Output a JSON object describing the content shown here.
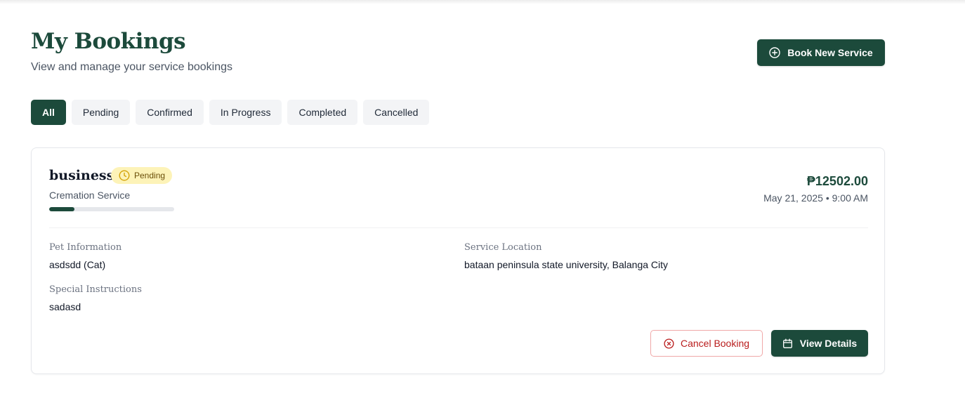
{
  "header": {
    "title": "My Bookings",
    "subtitle": "View and manage your service bookings",
    "book_new_label": "Book New Service"
  },
  "filters": {
    "tabs": [
      {
        "label": "All",
        "active": true
      },
      {
        "label": "Pending",
        "active": false
      },
      {
        "label": "Confirmed",
        "active": false
      },
      {
        "label": "In Progress",
        "active": false
      },
      {
        "label": "Completed",
        "active": false
      },
      {
        "label": "Cancelled",
        "active": false
      }
    ]
  },
  "bookings": [
    {
      "name": "business",
      "status": "Pending",
      "service_type": "Cremation Service",
      "progress": 0.2,
      "price": "₱12502.00",
      "datetime": "May 21, 2025 • 9:00 AM",
      "pet_info_label": "Pet Information",
      "pet_info_value": "asdsdd (Cat)",
      "location_label": "Service Location",
      "location_value": "bataan peninsula state university, Balanga City",
      "instructions_label": "Special Instructions",
      "instructions_value": "sadasd",
      "cancel_label": "Cancel Booking",
      "view_label": "View Details"
    }
  ],
  "colors": {
    "brand": "#1c4a3b",
    "pending_badge_bg": "#fdf3b8",
    "pending_badge_icon": "#d4a40b",
    "cancel_red": "#b91c1c",
    "cancel_border": "#f0a8a8"
  },
  "icons": {
    "book_new": "plus-circle-icon",
    "status": "clock-icon",
    "cancel": "x-circle-icon",
    "view": "calendar-icon"
  }
}
